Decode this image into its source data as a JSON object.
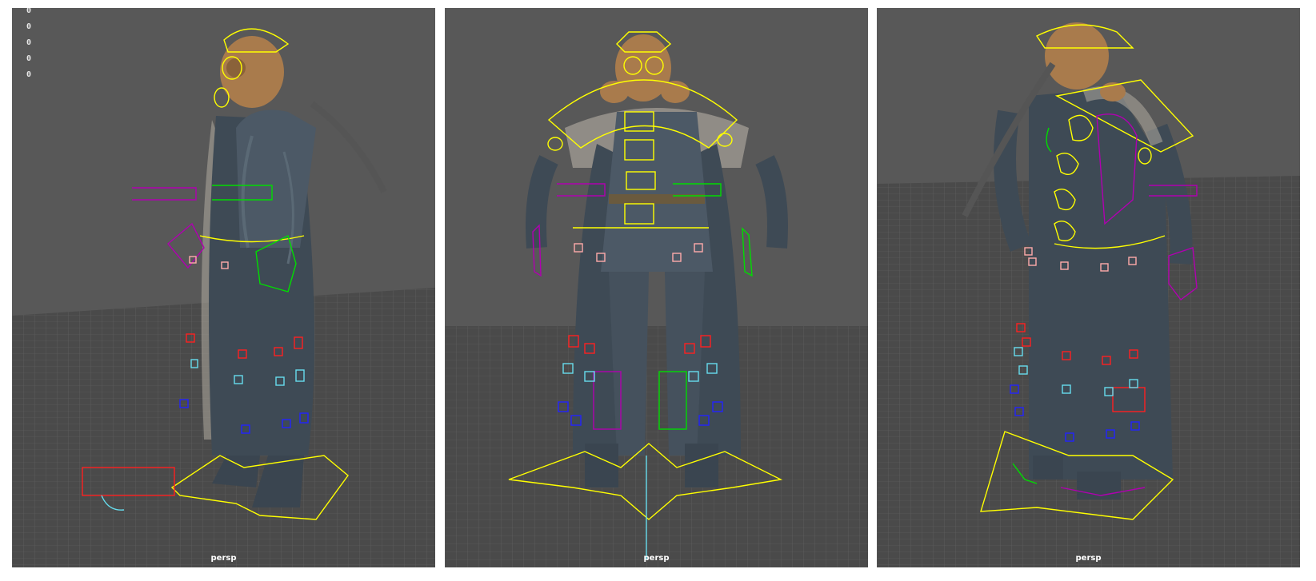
{
  "viewports": [
    {
      "id": "side",
      "camera": "persp"
    },
    {
      "id": "front",
      "camera": "persp"
    },
    {
      "id": "back",
      "camera": "persp"
    }
  ],
  "hud_values": [
    "0",
    "0",
    "0",
    "0",
    "0"
  ],
  "colors": {
    "viewport_bg": "#585858",
    "floor": "#4a4a4a",
    "grid": "#6a6a6a",
    "mesh": "#3e4a55",
    "mesh_highlight": "#5a6975",
    "mask": "#a97b4c",
    "ctrl_yellow": "#ffff00",
    "ctrl_magenta": "#b000b0",
    "ctrl_green": "#00dd00",
    "ctrl_red": "#ff2020",
    "ctrl_cyan": "#66ddee",
    "ctrl_blue": "#2222ff",
    "ctrl_pink": "#ffaaaa"
  }
}
